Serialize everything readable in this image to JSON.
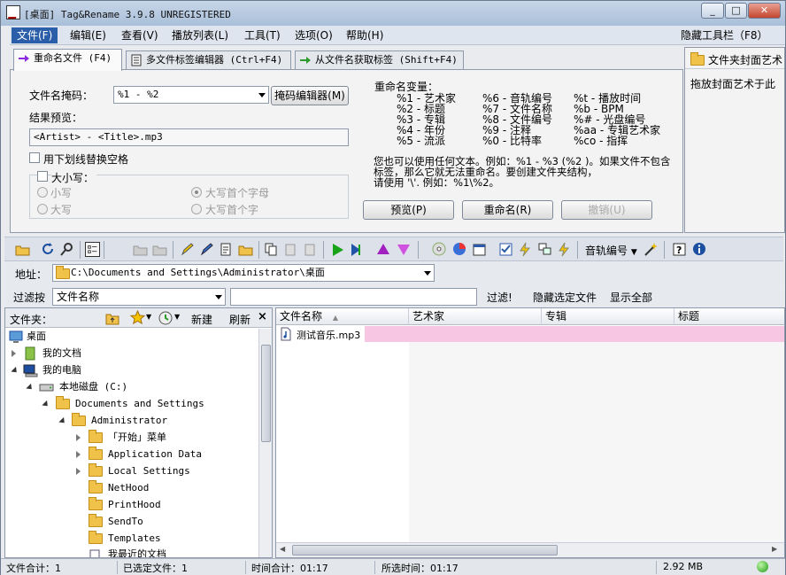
{
  "window": {
    "title": "[桌面] Tag&Rename 3.9.8 UNREGISTERED",
    "min": "_",
    "max": "□",
    "close": "✕"
  },
  "menu": [
    "文件(F)",
    "编辑(E)",
    "查看(V)",
    "播放列表(L)",
    "工具(T)",
    "选项(O)",
    "帮助(H)"
  ],
  "hide_toolbar": "隐藏工具栏（F8）",
  "tabs": [
    "重命名文件 (F4)",
    "多文件标签编辑器 (Ctrl+F4)",
    "从文件名获取标签 (Shift+F4)"
  ],
  "cover_tab": "文件夹封面艺术",
  "cover_hint": "拖放封面艺术于此",
  "rename": {
    "mask_label": "文件名掩码：",
    "mask_value": "%1 - %2",
    "mask_editor": "掩码编辑器(M)",
    "preview_label": "结果预览：",
    "preview_value": "<Artist> - <Title>.mp3",
    "underscore": "用下划线替换空格",
    "case_label": "大小写：",
    "lower": "小写",
    "upper": "大写",
    "first_letter": "大写首个字母",
    "first_word": "大写首个字",
    "vars_title": "重命名变量：",
    "vars_col1": [
      "%1 - 艺术家",
      "%2 - 标题",
      "%3 - 专辑",
      "%4 - 年份",
      "%5 - 流派"
    ],
    "vars_col2": [
      "%6 - 音轨编号",
      "%7 - 文件名称",
      "%8 - 文件编号",
      "%9 - 注释",
      "%0 - 比特率"
    ],
    "vars_col3": [
      "%t - 播放时间",
      "%b - BPM",
      "%# - 光盘编号",
      "%aa - 专辑艺术家",
      "%co - 指挥"
    ],
    "note_lines": [
      "您也可以使用任何文本。例如：%1 - %3 (%2 )。如果文件不包含",
      "标签，那么它就无法重命名。要创建文件夹结构，",
      "请使用 '\\'. 例如：%1\\%2。"
    ],
    "preview_btn": "预览(P)",
    "rename_btn": "重命名(R)",
    "undo_btn": "撤销(U)"
  },
  "toolbar": {
    "track_number": "音轨编号"
  },
  "address": {
    "label": "地址：",
    "value": "C:\\Documents and Settings\\Administrator\\桌面"
  },
  "filter": {
    "label": "过滤按",
    "field": "文件名称",
    "value": "",
    "apply": "过滤!",
    "hide_selected": "隐藏选定文件",
    "show_all": "显示全部"
  },
  "tree": {
    "header": "文件夹：",
    "new": "新建",
    "refresh": "刷新",
    "nodes": [
      "桌面",
      "我的文档",
      "我的电脑",
      "本地磁盘 (C:)",
      "Documents and Settings",
      "Administrator",
      "「开始」菜单",
      "Application Data",
      "Local Settings",
      "NetHood",
      "PrintHood",
      "SendTo",
      "Templates",
      "我最近的文档"
    ]
  },
  "list": {
    "columns": [
      "文件名称",
      "艺术家",
      "专辑",
      "标题"
    ],
    "rows": [
      {
        "name": "测试音乐.mp3"
      }
    ]
  },
  "status": {
    "total_files": "文件合计：1",
    "selected_files": "已选定文件：1",
    "total_time": "时间合计：01:17",
    "selected_time": "所选时间：01:17",
    "size": "2.92 MB"
  },
  "colors": {
    "menu_active": "#2a5ea8",
    "row_highlight": "#f7c6e2"
  }
}
